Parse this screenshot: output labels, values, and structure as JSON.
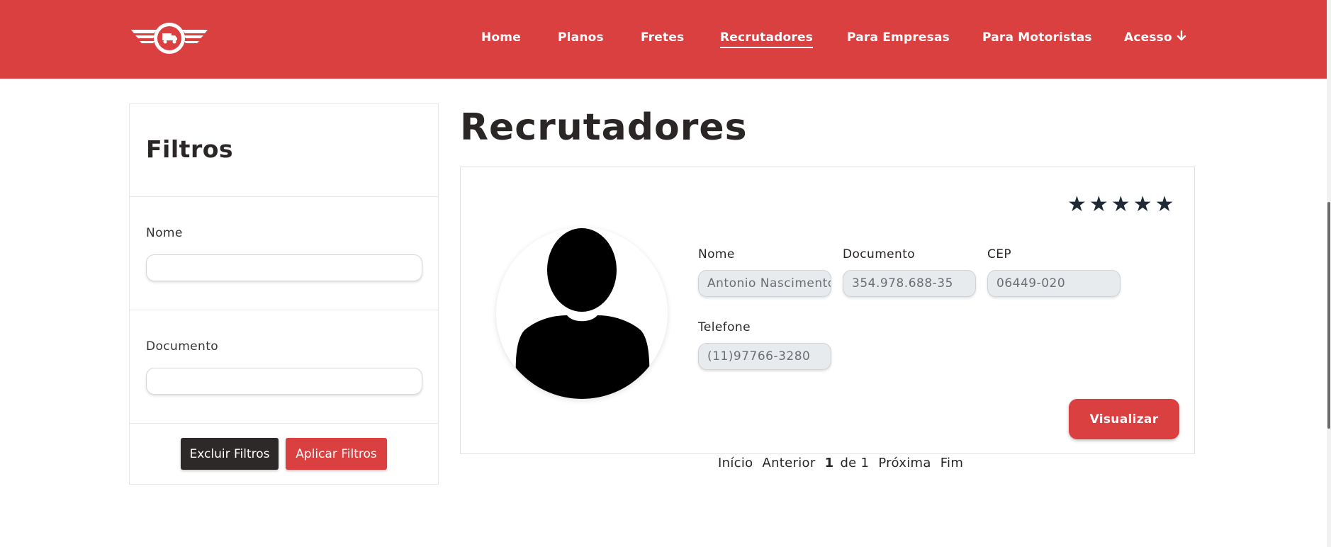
{
  "header": {
    "logo_alt": "logo",
    "nav": [
      {
        "label": "Home",
        "active": false
      },
      {
        "label": "Planos",
        "active": false
      },
      {
        "label": "Fretes",
        "active": false
      },
      {
        "label": "Recrutadores",
        "active": true
      },
      {
        "label": "Para Empresas",
        "active": false
      },
      {
        "label": "Para Motoristas",
        "active": false
      },
      {
        "label": "Acesso",
        "active": false,
        "icon": "arrow-down-icon"
      }
    ]
  },
  "filters": {
    "title": "Filtros",
    "name_label": "Nome",
    "name_value": "",
    "document_label": "Documento",
    "document_value": "",
    "clear_label": "Excluir Filtros",
    "apply_label": "Aplicar Filtros"
  },
  "main": {
    "title": "Recrutadores",
    "card": {
      "avatar_icon": "user-silhouette-icon",
      "rating": 5,
      "stars": [
        "★",
        "★",
        "★",
        "★",
        "★"
      ],
      "name_label": "Nome",
      "name_value": "Antonio Nascimento",
      "document_label": "Documento",
      "document_value": "354.978.688-35",
      "cep_label": "CEP",
      "cep_value": "06449-020",
      "phone_label": "Telefone",
      "phone_value": "(11)97766-3280",
      "view_label": "Visualizar"
    }
  },
  "pagination": {
    "first": "Início",
    "prev": "Anterior",
    "current": "1",
    "of": "de 1",
    "next": "Próxima",
    "last": "Fim"
  },
  "colors": {
    "brand_red": "#db4041",
    "dark": "#2e2929",
    "star": "#1f2a36"
  }
}
